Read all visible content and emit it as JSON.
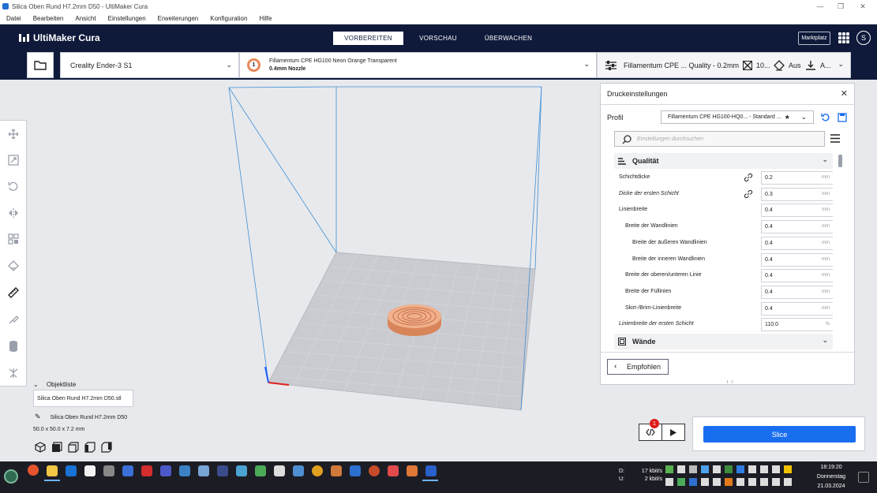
{
  "window": {
    "title": "Silica Oben Rund H7.2mm D50 - UltiMaker Cura",
    "controls": [
      "minimize-icon",
      "maximize-icon",
      "close-icon"
    ]
  },
  "menu": [
    "Datei",
    "Bearbeiten",
    "Ansicht",
    "Einstellungen",
    "Erweiterungen",
    "Konfiguration",
    "Hilfe"
  ],
  "header": {
    "logo": "UltiMaker Cura",
    "stages": [
      "VORBEREITEN",
      "VORSCHAU",
      "ÜBERWACHEN"
    ],
    "active_stage": 0,
    "marketplace": "Marktplatz",
    "avatar": "S"
  },
  "toolbar": {
    "printer": "Creality Ender-3 S1",
    "material_index": "1",
    "material": "Fillamentum CPE HG100 Neon Orange Transparent",
    "nozzle": "0.4mm Nozzle",
    "profile_summary": "Fillamentum CPE ... Quality - 0.2mm",
    "infill": "10...",
    "support": "Aus",
    "adhesion": "A..."
  },
  "print_settings": {
    "title": "Druckeinstellungen",
    "profile_label": "Profil",
    "profile_value": "Fillamentum CPE HG100-HQ0... - Standard ...",
    "search_placeholder": "Einstellungen durchsuchen",
    "categories": [
      "Qualität",
      "Wände"
    ],
    "rows": [
      {
        "label": "Schichtdicke",
        "value": "0.2",
        "unit": "mm",
        "indent": 0,
        "italic": false,
        "linked": true
      },
      {
        "label": "Dicke der ersten Schicht",
        "value": "0.3",
        "unit": "mm",
        "indent": 0,
        "italic": true,
        "linked": true
      },
      {
        "label": "Linienbreite",
        "value": "0.4",
        "unit": "mm",
        "indent": 0,
        "italic": false,
        "linked": false
      },
      {
        "label": "Breite der Wandlinien",
        "value": "0.4",
        "unit": "mm",
        "indent": 1,
        "italic": false,
        "linked": false
      },
      {
        "label": "Breite der äußeren Wandlinien",
        "value": "0.4",
        "unit": "mm",
        "indent": 2,
        "italic": false,
        "linked": false
      },
      {
        "label": "Breite der inneren Wandlinien",
        "value": "0.4",
        "unit": "mm",
        "indent": 2,
        "italic": false,
        "linked": false
      },
      {
        "label": "Breite der oberen/unteren Linie",
        "value": "0.4",
        "unit": "mm",
        "indent": 1,
        "italic": false,
        "linked": false
      },
      {
        "label": "Breite der Füllinien",
        "value": "0.4",
        "unit": "mm",
        "indent": 1,
        "italic": false,
        "linked": false
      },
      {
        "label": "Skirt-/Brim-Linienbreite",
        "value": "0.4",
        "unit": "mm",
        "indent": 1,
        "italic": false,
        "linked": false
      },
      {
        "label": "Linienbreite der ersten Schicht",
        "value": "110.0",
        "unit": "%",
        "indent": 0,
        "italic": true,
        "linked": false
      }
    ],
    "recommended_button": "Empfohlen"
  },
  "objects": {
    "title": "Objektliste",
    "file": "Silica Oben Rund H7.2mm D50.stl",
    "object_name": "Silica Oben Rund H7.2mm D50",
    "dimensions": "50.0 x 50.0 x 7.2 mm"
  },
  "slice": {
    "button": "Slice",
    "notification_count": "1"
  },
  "taskbar": {
    "net_down_label": "D:",
    "net_up_label": "U:",
    "net_down": "17 kbit/s",
    "net_up": "2 kbit/s",
    "time": "18:19:20",
    "day": "Donnerstag",
    "date": "21.03.2024"
  },
  "colors": {
    "header": "#0f1a3a",
    "accent": "#196ef0",
    "model": "#e8a27a"
  }
}
